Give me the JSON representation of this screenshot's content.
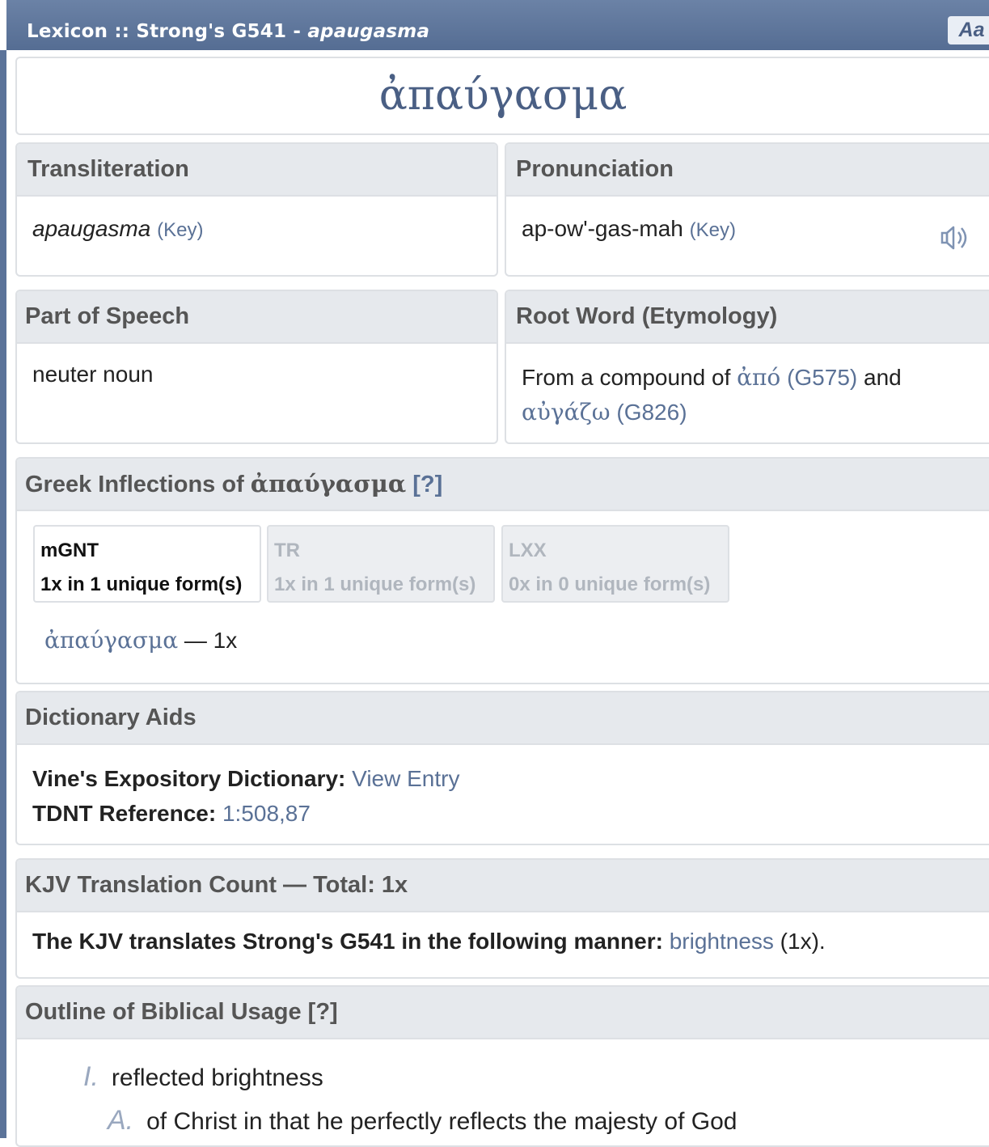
{
  "titlebar": {
    "prefix": "Lexicon :: Strong's G541 - ",
    "word": "apaugasma",
    "font_button": "Aa"
  },
  "lemma": "ἀπαύγασμα",
  "transliteration": {
    "heading": "Transliteration",
    "value": "apaugasma",
    "key": "(Key)"
  },
  "pronunciation": {
    "heading": "Pronunciation",
    "value": "ap-ow'-gas-mah",
    "key": "(Key)",
    "icon": "speaker-icon"
  },
  "part_of_speech": {
    "heading": "Part of Speech",
    "value": "neuter noun"
  },
  "root_word": {
    "heading": "Root Word (Etymology)",
    "prefix": "From a compound of ",
    "word1": "ἀπό",
    "ref1": "(G575)",
    "middle": " and",
    "word2": "αὐγάζω",
    "ref2": "(G826)"
  },
  "inflections": {
    "heading_prefix": "Greek Inflections of ",
    "heading_word": "ἀπαύγασμα",
    "heading_help": " [?]",
    "tabs": [
      {
        "name": "mGNT",
        "count": "1x in 1 unique form(s)"
      },
      {
        "name": "TR",
        "count": "1x in 1 unique form(s)"
      },
      {
        "name": "LXX",
        "count": "0x in 0 unique form(s)"
      }
    ],
    "form_word": "ἀπαύγασμα",
    "form_count": " — 1x"
  },
  "dictionary_aids": {
    "heading": "Dictionary Aids",
    "vine_label": "Vine's Expository Dictionary:",
    "vine_link": "View Entry",
    "tdnt_label": "TDNT Reference:",
    "tdnt_value": "1:508,87"
  },
  "kjv": {
    "heading": "KJV Translation Count — Total: 1x",
    "label": "The KJV translates Strong's G541 in the following manner:",
    "word": "brightness",
    "count": " (1x)."
  },
  "outline": {
    "heading": "Outline of Biblical Usage [?]",
    "items": [
      {
        "num": "I.",
        "text": "reflected brightness"
      },
      {
        "num": "A.",
        "text": "of Christ in that he perfectly reflects the majesty of God"
      }
    ]
  }
}
